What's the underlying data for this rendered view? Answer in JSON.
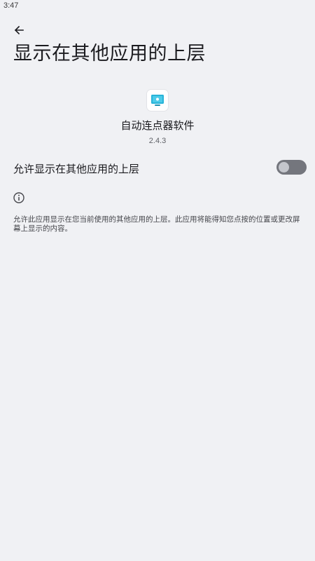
{
  "status_bar": {
    "time": "3:47"
  },
  "header": {
    "back_icon": "arrow-back-icon",
    "title": "显示在其他应用的上层"
  },
  "app": {
    "icon": "app-icon",
    "name": "自动连点器软件",
    "version": "2.4.3"
  },
  "permission": {
    "label": "允许显示在其他应用的上层",
    "enabled": false
  },
  "info": {
    "icon": "info-icon",
    "description": "允许此应用显示在您当前使用的其他应用的上层。此应用将能得知您点按的位置或更改屏幕上显示的内容。"
  },
  "colors": {
    "background": "#f0f1f4",
    "toggle_track_off": "#74767d",
    "toggle_thumb_off": "#c4c6cc",
    "app_icon_accent": "#27b3d8"
  }
}
